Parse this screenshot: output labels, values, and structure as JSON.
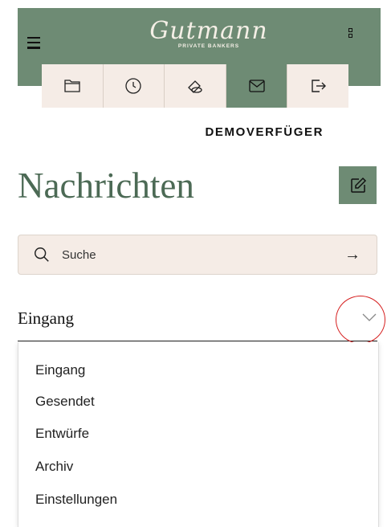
{
  "header": {
    "logo_script": "Gutmann",
    "logo_sub": "PRIVATE BANKERS",
    "brand_color": "#6e8b74"
  },
  "tabs": [
    {
      "icon": "folder-icon",
      "active": false
    },
    {
      "icon": "clock-icon",
      "active": false
    },
    {
      "icon": "coins-icon",
      "active": false
    },
    {
      "icon": "mail-icon",
      "active": true
    },
    {
      "icon": "logout-icon",
      "active": false
    }
  ],
  "user": {
    "name": "DEMOVERFÜGER"
  },
  "page": {
    "title": "Nachrichten"
  },
  "compose": {
    "icon": "edit-icon"
  },
  "search": {
    "placeholder": "Suche",
    "submit_icon": "arrow-right-icon"
  },
  "folder_select": {
    "selected": "Eingang",
    "icon": "chevron-down-icon",
    "options": [
      "Eingang",
      "Gesendet",
      "Entwürfe",
      "Archiv",
      "Einstellungen"
    ]
  },
  "colors": {
    "accent": "#6e8b74",
    "title": "#4c6a55",
    "search_bg": "#f5ece6",
    "highlight": "#d62020"
  }
}
